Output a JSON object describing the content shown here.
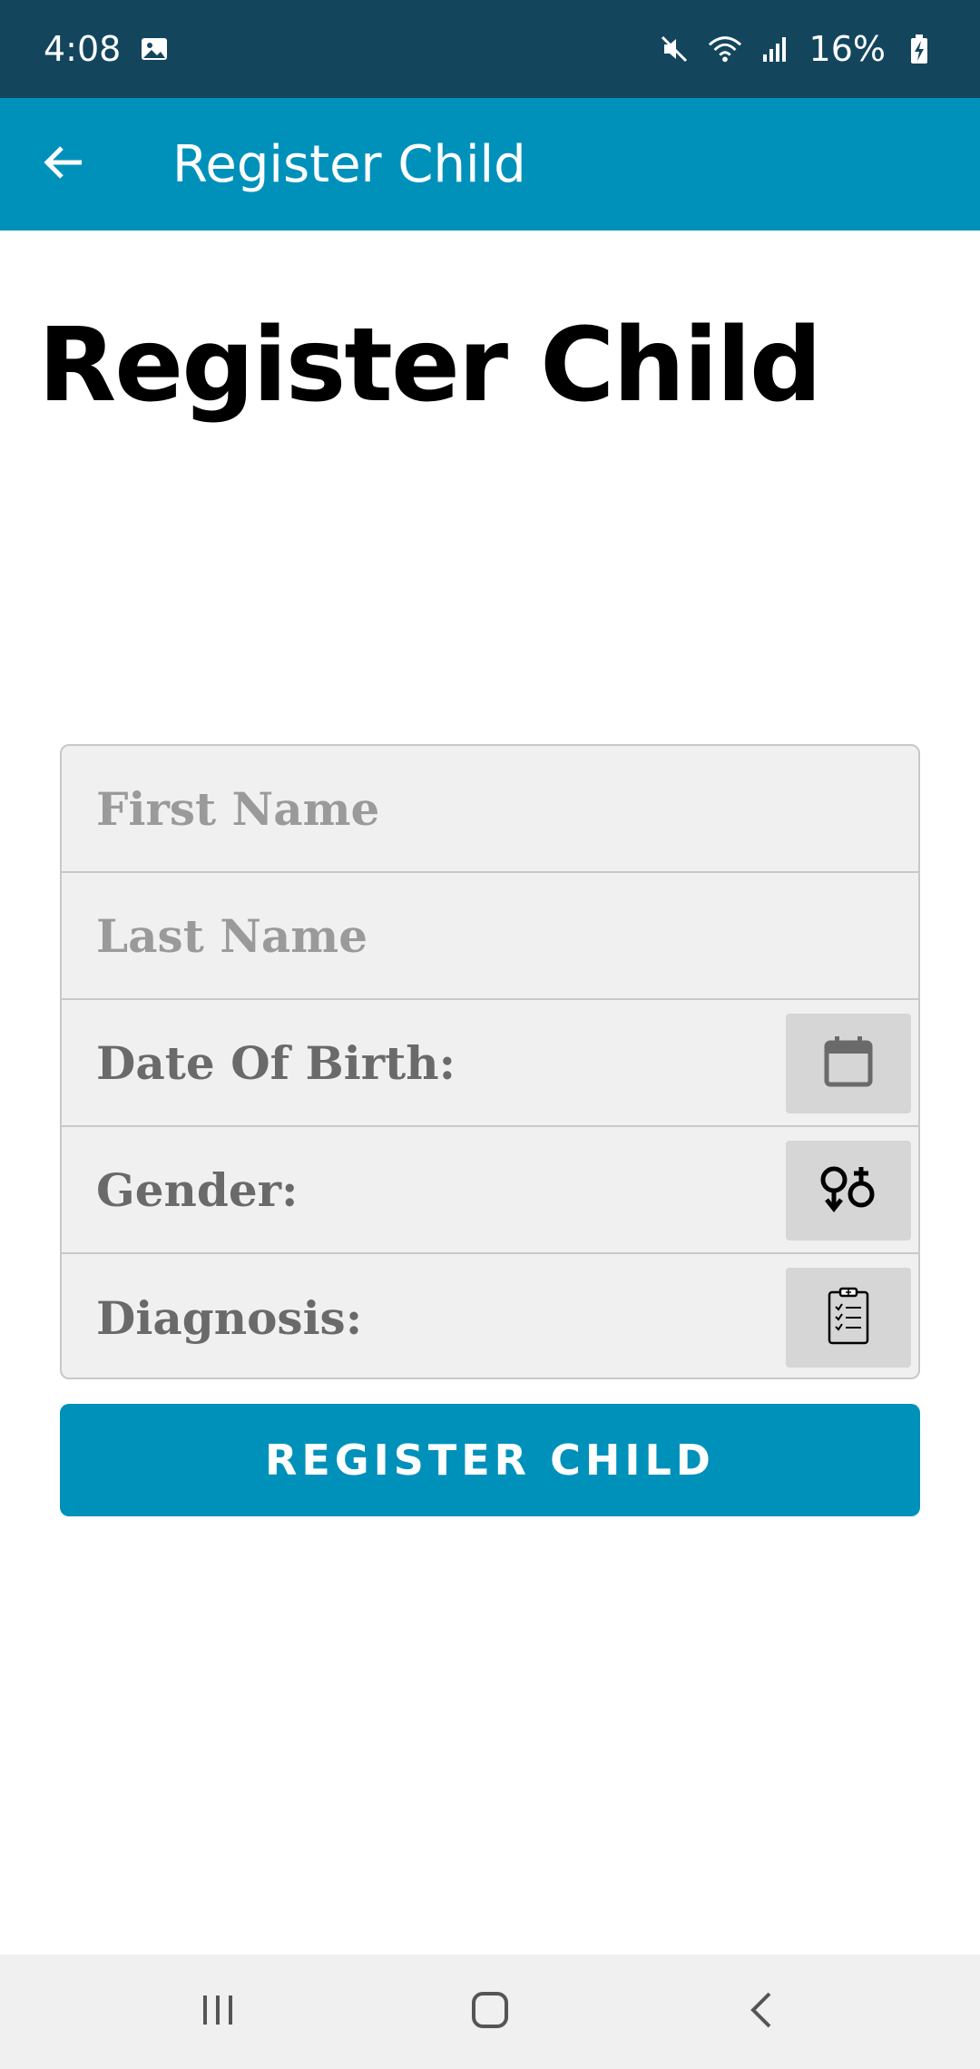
{
  "status_bar": {
    "time": "4:08",
    "battery_percent": "16%",
    "icons": [
      "image-icon",
      "mute-icon",
      "wifi-icon",
      "signal-icon",
      "battery-charging-icon"
    ]
  },
  "app_bar": {
    "title": "Register Child",
    "back_icon": "arrow-left-icon"
  },
  "page": {
    "heading": "Register Child"
  },
  "form": {
    "first_name": {
      "placeholder": "First Name",
      "value": ""
    },
    "last_name": {
      "placeholder": "Last Name",
      "value": ""
    },
    "date_of_birth": {
      "label": "Date Of Birth:",
      "icon": "calendar-icon"
    },
    "gender": {
      "label": "Gender:",
      "icon": "gender-icon"
    },
    "diagnosis": {
      "label": "Diagnosis:",
      "icon": "clipboard-icon"
    }
  },
  "actions": {
    "register_label": "REGISTER CHILD"
  },
  "nav_bar": {
    "buttons": [
      "recent-apps-icon",
      "home-icon",
      "back-icon"
    ]
  },
  "colors": {
    "status_bar": "#13465d",
    "accent": "#0091bb",
    "form_bg": "#f0f0f0",
    "picker_bg": "#d6d6d6"
  }
}
